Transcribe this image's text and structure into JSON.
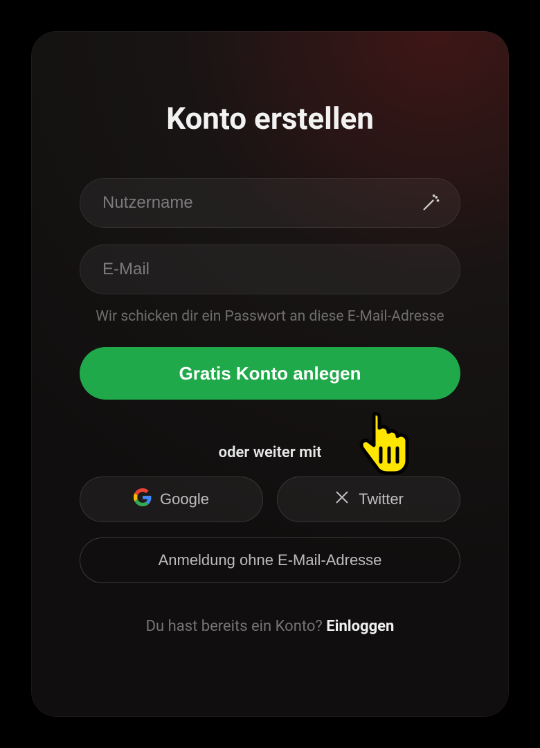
{
  "title": "Konto erstellen",
  "username": {
    "placeholder": "Nutzername"
  },
  "email": {
    "placeholder": "E-Mail"
  },
  "email_hint": "Wir schicken dir ein Passwort an diese E-Mail-Adresse",
  "submit_label": "Gratis Konto anlegen",
  "divider_label": "oder weiter mit",
  "social": {
    "google": "Google",
    "twitter": "Twitter"
  },
  "no_email_label": "Anmeldung ohne E-Mail-Adresse",
  "login_prefix": "Du hast bereits ein Konto? ",
  "login_link": "Einloggen",
  "colors": {
    "primary": "#1fa94a"
  }
}
